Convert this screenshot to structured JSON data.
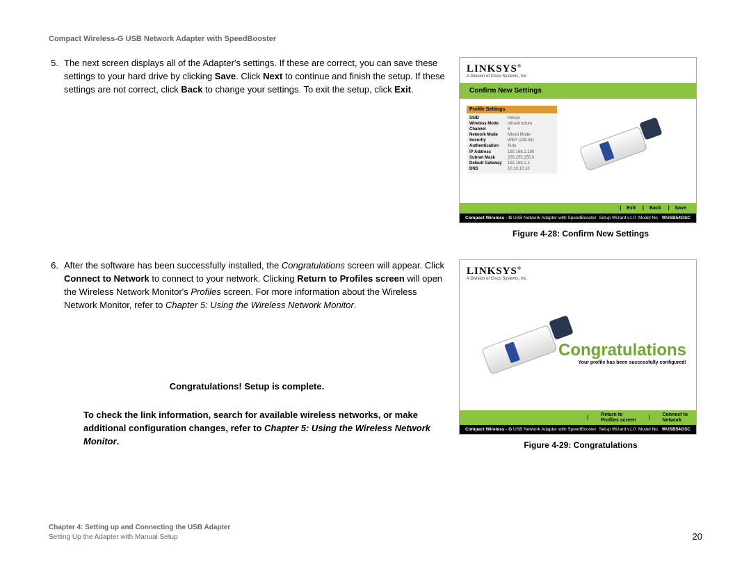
{
  "doc_title": "Compact Wireless-G USB Network Adapter with SpeedBooster",
  "step5": {
    "num": "5.",
    "t1": "The next screen displays all of the Adapter's settings. If these are correct, you can save these settings to your hard drive by clicking ",
    "save": "Save",
    "t2": ". Click ",
    "next": "Next",
    "t3": " to continue and finish the setup. If these settings are not correct, click ",
    "back": "Back",
    "t4": " to change your settings. To exit the setup, click ",
    "exit": "Exit",
    "t5": "."
  },
  "step6": {
    "num": "6.",
    "t1": "After the software has been successfully installed, the ",
    "congrats": "Congratulations",
    "t2": " screen will appear. Click ",
    "connect": "Connect to Network",
    "t3": " to connect to your network. Clicking ",
    "return": "Return to Profiles screen",
    "t4": " will open the Wireless Network Monitor's ",
    "profiles": "Profiles",
    "t5": " screen. For more information about the Wireless Network Monitor, refer to ",
    "chapter": "Chapter 5: Using the Wireless Network Monitor",
    "t6": "."
  },
  "congrats_line": "Congratulations! Setup is complete.",
  "closing": {
    "t1": "To check the link information, search for available wireless networks, or make additional configuration changes, refer to ",
    "ch": "Chapter 5: Using the Wireless Network Monitor",
    "t2": "."
  },
  "fig28": {
    "caption": "Figure 4-28: Confirm New Settings",
    "brand": "LINKSYS",
    "reg": "®",
    "tag": "A Division of Cisco Systems, Inc.",
    "green": "Confirm New Settings",
    "panel_hdr": "Profile Settings",
    "rows": [
      {
        "k": "SSID",
        "v": "linksys"
      },
      {
        "k": "Wireless Mode",
        "v": "Infrastructure"
      },
      {
        "k": "Channel",
        "v": "6"
      },
      {
        "k": "Network Mode",
        "v": "Mixed Mode"
      },
      {
        "k": "Security",
        "v": "WEP (128-bit)"
      },
      {
        "k": "Authentication",
        "v": "Auto"
      },
      {
        "k": "IP Address",
        "v": "192.168.1.100"
      },
      {
        "k": "Subnet Mask",
        "v": "255.255.255.0"
      },
      {
        "k": "Default Gateway",
        "v": "192.168.1.1"
      },
      {
        "k": "DNS",
        "v": "10.10.10.10"
      }
    ],
    "btns": {
      "exit": "Exit",
      "back": "Back",
      "save": "Save"
    },
    "footer_l1": "Compact Wireless - G",
    "footer_l2": "USB Network Adapter",
    "footer_l3": "with",
    "footer_l4": "SpeedBooster",
    "footer_mid": "Setup Wizard v1.0",
    "footer_model_lbl": "Model No.",
    "footer_model": "WUSB54GSC"
  },
  "fig29": {
    "caption": "Figure 4-29: Congratulations",
    "big": "Congratulations",
    "sub": "Your profile has been successfully configured!",
    "btn1a": "Return to",
    "btn1b": "Profiles screen",
    "btn2a": "Connect to",
    "btn2b": "Network"
  },
  "footer": {
    "line1": "Chapter 4: Setting up and Connecting the USB Adapter",
    "line2": "Setting Up the Adapter with Manual Setup",
    "page": "20"
  }
}
